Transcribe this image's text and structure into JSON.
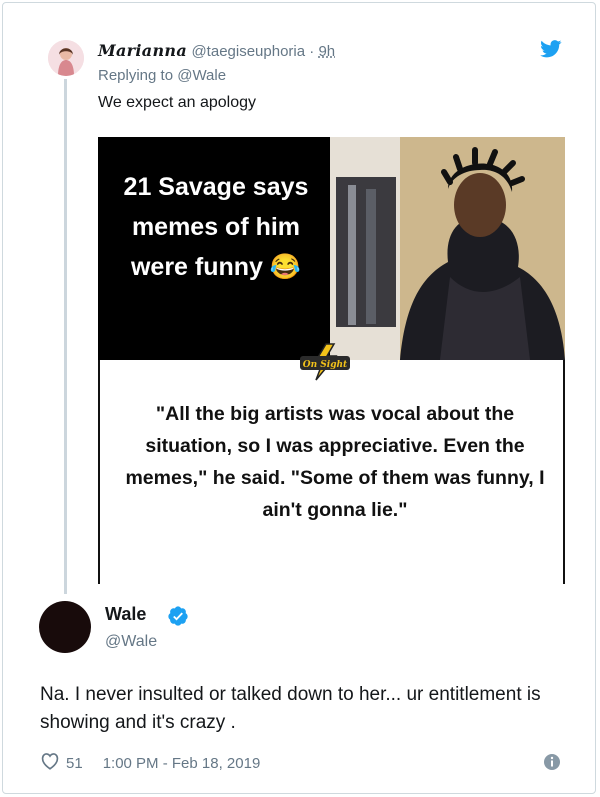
{
  "reply": {
    "display_name": "Marianna",
    "handle": "@taegiseuphoria",
    "separator": " · ",
    "time": "9h",
    "replying_to": "Replying to @Wale",
    "text": "We expect an apology"
  },
  "media": {
    "title": "21 Savage says memes of him were funny 😂",
    "badge_text": "On Sight",
    "quote": "\"All the big artists was vocal about the situation, so I was appreciative. Even the memes,\" he said. \"Some of them was funny, I ain't gonna lie.\""
  },
  "tweet": {
    "display_name": "Wale",
    "handle": "@Wale",
    "text": "Na. I never insulted or talked down to her... ur entitlement is showing and it's crazy .",
    "likes": "51",
    "timestamp": "1:00 PM - Feb 18, 2019"
  },
  "colors": {
    "twitter_blue": "#1da1f2",
    "secondary_text": "#657786",
    "thread_line": "#ccd6dd"
  },
  "icons": [
    "twitter-bird-icon",
    "verified-badge-icon",
    "heart-icon",
    "info-icon"
  ]
}
